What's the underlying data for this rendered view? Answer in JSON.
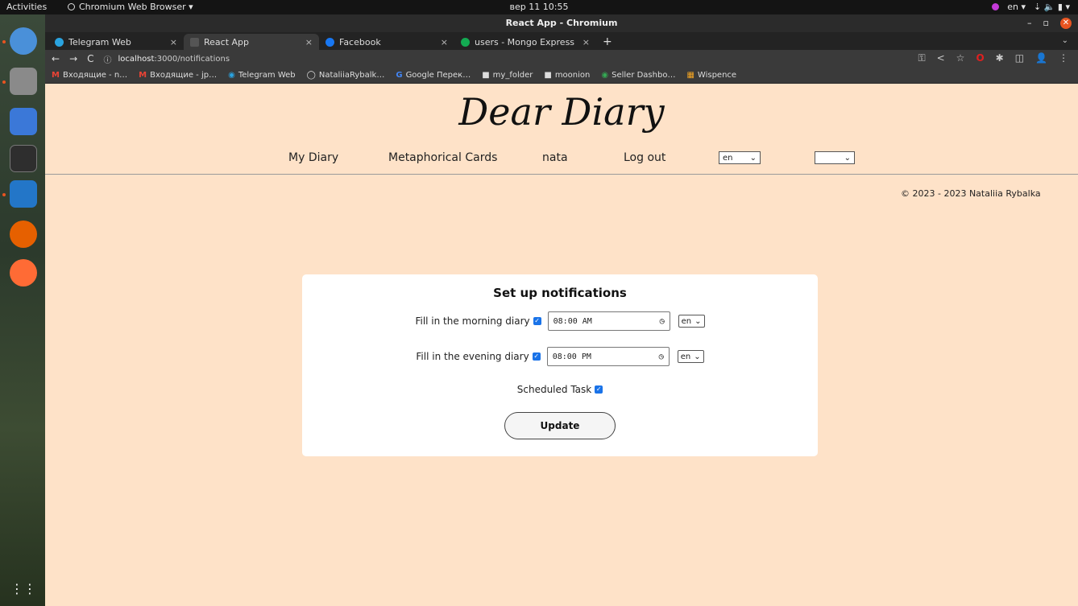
{
  "system_bar": {
    "activities": "Activities",
    "app_name": "Chromium Web Browser ▾",
    "clock": "вер 11  10:55",
    "lang": "en ▾",
    "status_icons": "⇣ 🔈 ▮ ▾"
  },
  "window": {
    "title": "React App - Chromium",
    "minimize": "–",
    "maximize": "▫",
    "close": "✕"
  },
  "tabs": [
    {
      "label": "Telegram Web",
      "color": "#2aa3e0",
      "active": false
    },
    {
      "label": "React App",
      "color": "#555555",
      "active": true
    },
    {
      "label": "Facebook",
      "color": "#1877f2",
      "active": false
    },
    {
      "label": "users - Mongo Express",
      "color": "#13aa52",
      "active": false
    }
  ],
  "tab_controls": {
    "close": "×",
    "new_tab": "+",
    "menu": "⌄"
  },
  "address_bar": {
    "back": "←",
    "forward": "→",
    "reload": "C",
    "info": "ⓘ",
    "host": "localhost",
    "path": ":3000/notifications",
    "right_icons": [
      "⚿",
      "<",
      "☆",
      "O",
      "✱",
      "◫",
      "👤",
      "⋮"
    ]
  },
  "bookmarks": [
    {
      "icon": "M",
      "label": "Входящие - n…",
      "color": "#ea4335"
    },
    {
      "icon": "M",
      "label": "Входящие - jp…",
      "color": "#ea4335"
    },
    {
      "icon": "◉",
      "label": "Telegram Web",
      "color": "#2aa3e0"
    },
    {
      "icon": "◯",
      "label": "NataliiaRybalk…",
      "color": "#ffffff"
    },
    {
      "icon": "G",
      "label": "Google Перек…",
      "color": "#4285f4"
    },
    {
      "icon": "■",
      "label": "my_folder",
      "color": "#cccccc"
    },
    {
      "icon": "■",
      "label": "moonion",
      "color": "#cccccc"
    },
    {
      "icon": "◉",
      "label": "Seller Dashbo…",
      "color": "#34a853"
    },
    {
      "icon": "▦",
      "label": "Wispence",
      "color": "#f5a623"
    }
  ],
  "site": {
    "title": "Dear Diary",
    "nav": {
      "my_diary": "My Diary",
      "cards": "Metaphorical Cards",
      "user": "nata",
      "logout": "Log out",
      "lang_value": "en",
      "chevron": "⌄"
    },
    "copyright": "© 2023 - 2023 Nataliia Rybalka"
  },
  "notifications": {
    "title": "Set up notifications",
    "morning": {
      "label": "Fill in the morning diary",
      "time": "08:00 AM",
      "lang": "en",
      "checked": true
    },
    "evening": {
      "label": "Fill in the evening diary",
      "time": "08:00 PM",
      "lang": "en",
      "checked": true
    },
    "scheduled": {
      "label": "Scheduled Task",
      "checked": true
    },
    "check_mark": "✓",
    "clock_icon": "◷",
    "chevron": "⌄",
    "update_label": "Update"
  },
  "colors": {
    "page_bg": "#fee2c8",
    "accent": "#1a73e8",
    "ubuntu_orange": "#e95420"
  }
}
